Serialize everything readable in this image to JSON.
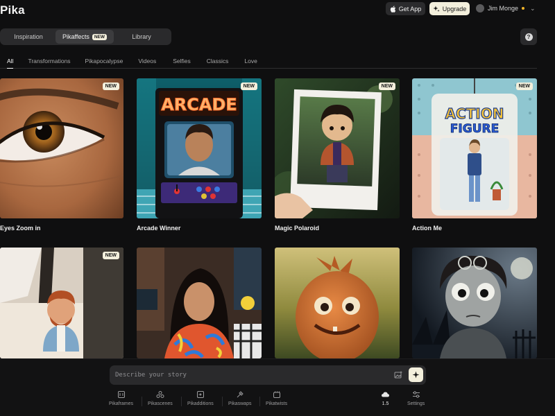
{
  "app": {
    "logo": "Pika"
  },
  "header": {
    "get_app_label": "Get App",
    "upgrade_label": "Upgrade",
    "user_name": "Jim Monge"
  },
  "main_tabs": [
    {
      "label": "Inspiration"
    },
    {
      "label": "Pikaffects",
      "badge": "NEW",
      "active": true
    },
    {
      "label": "Library"
    }
  ],
  "help_label": "?",
  "categories": [
    {
      "label": "All",
      "active": true
    },
    {
      "label": "Transformations"
    },
    {
      "label": "Pikapocalypse"
    },
    {
      "label": "Videos"
    },
    {
      "label": "Selfies"
    },
    {
      "label": "Classics"
    },
    {
      "label": "Love"
    }
  ],
  "cards": [
    {
      "title": "Eyes Zoom in",
      "badge": "NEW"
    },
    {
      "title": "Arcade Winner",
      "badge": "NEW",
      "sign_text": "ARCADE"
    },
    {
      "title": "Magic Polaroid",
      "badge": "NEW"
    },
    {
      "title": "Action Me",
      "badge": "NEW",
      "box_text_1": "ACTION",
      "box_text_2": "FIGURE"
    },
    {
      "title": "",
      "badge": "NEW"
    },
    {
      "title": "",
      "badge": ""
    },
    {
      "title": "",
      "badge": ""
    },
    {
      "title": "",
      "badge": ""
    }
  ],
  "prompt": {
    "placeholder": "Describe your story"
  },
  "tools": [
    {
      "label": "Pikaframes",
      "icon": "frames-icon"
    },
    {
      "label": "Pikascenes",
      "icon": "scenes-icon"
    },
    {
      "label": "Pikadditions",
      "icon": "additions-icon"
    },
    {
      "label": "Pikaswaps",
      "icon": "swaps-icon"
    },
    {
      "label": "Pikatwists",
      "icon": "twists-icon"
    }
  ],
  "model": {
    "version": "1.5",
    "icon": "cloud-icon"
  },
  "settings": {
    "label": "Settings",
    "icon": "sliders-icon"
  },
  "colors": {
    "background": "#0f0f10",
    "badge": "#f3efdc",
    "accent_dot": "#f0b429"
  }
}
